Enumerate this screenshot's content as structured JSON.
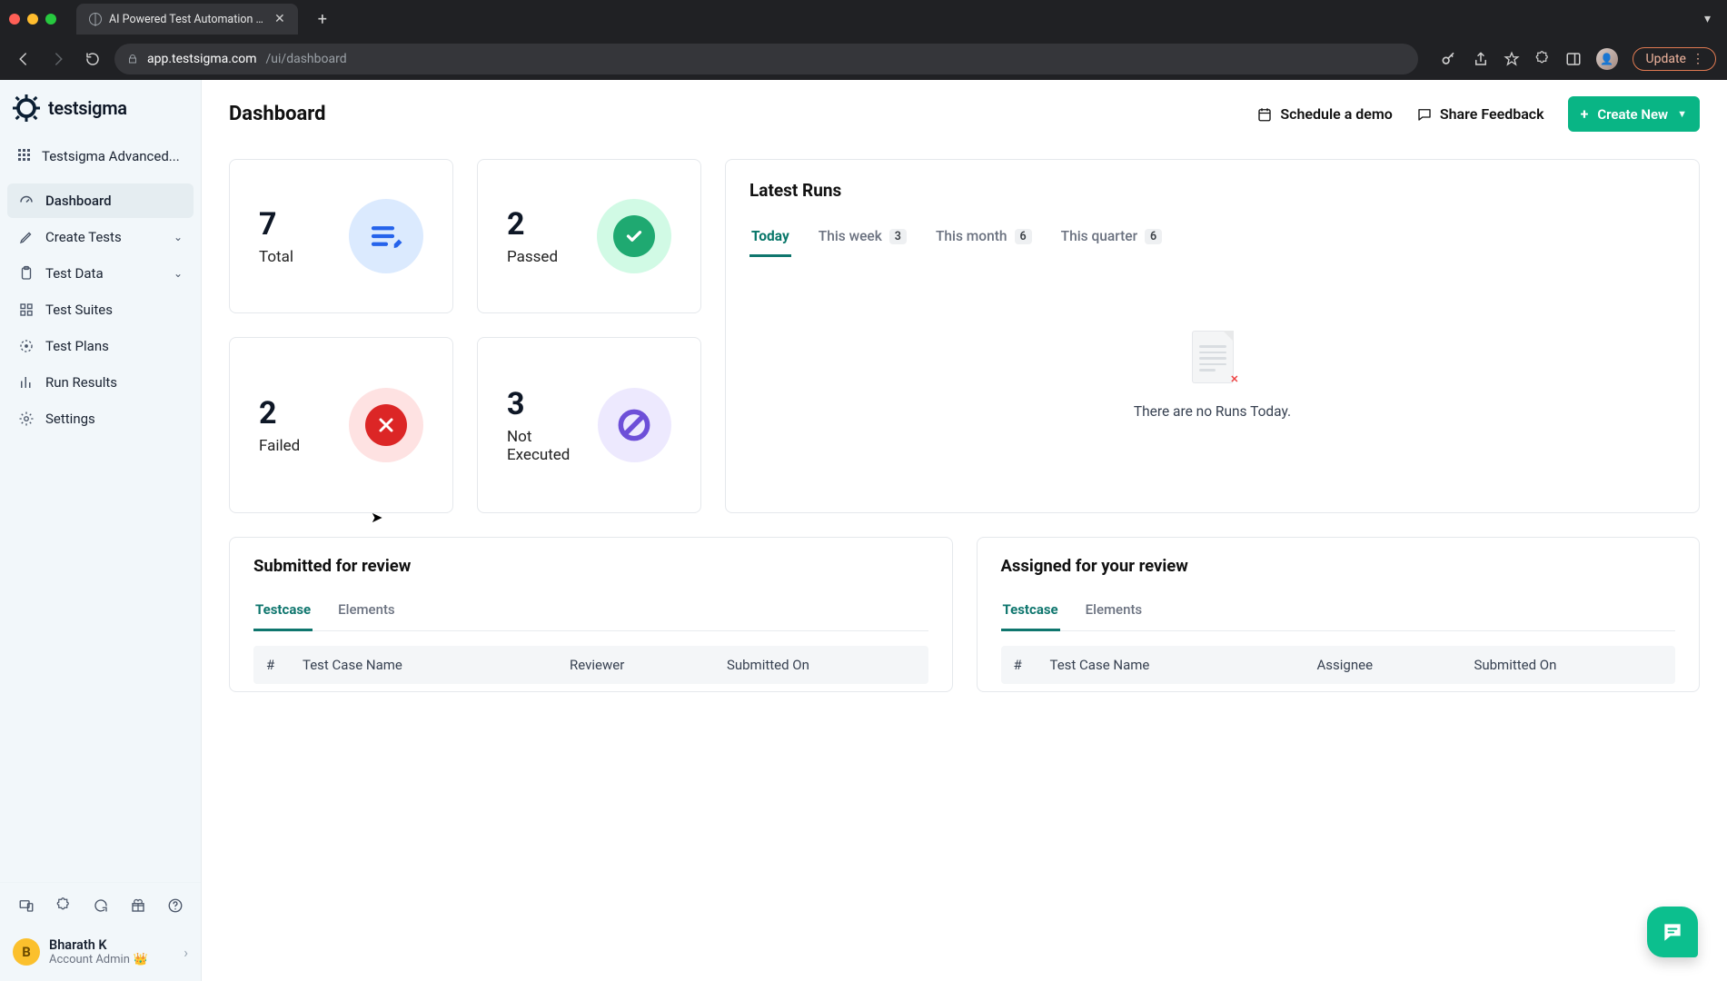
{
  "chrome": {
    "tab_title": "AI Powered Test Automation Pl",
    "url_host": "app.testsigma.com",
    "url_path": "/ui/dashboard",
    "update_label": "Update"
  },
  "brand": {
    "name": "testsigma"
  },
  "project": {
    "name": "Testsigma Advanced..."
  },
  "nav": {
    "dashboard": "Dashboard",
    "create_tests": "Create Tests",
    "test_data": "Test Data",
    "test_suites": "Test Suites",
    "test_plans": "Test Plans",
    "run_results": "Run Results",
    "settings": "Settings"
  },
  "user": {
    "initial": "B",
    "name": "Bharath K",
    "role": "Account Admin"
  },
  "header": {
    "title": "Dashboard",
    "schedule_demo": "Schedule a demo",
    "share_feedback": "Share Feedback",
    "create_new": "Create New"
  },
  "stats": {
    "total": {
      "value": "7",
      "label": "Total"
    },
    "passed": {
      "value": "2",
      "label": "Passed"
    },
    "failed": {
      "value": "2",
      "label": "Failed"
    },
    "not_executed": {
      "value": "3",
      "label": "Not Executed"
    }
  },
  "runs": {
    "title": "Latest Runs",
    "tabs": {
      "today": "Today",
      "week": "This week",
      "week_count": "3",
      "month": "This month",
      "month_count": "6",
      "quarter": "This quarter",
      "quarter_count": "6"
    },
    "empty_text": "There are no Runs Today."
  },
  "review": {
    "submitted": {
      "title": "Submitted for review",
      "tab_testcase": "Testcase",
      "tab_elements": "Elements",
      "col_hash": "#",
      "col_name": "Test Case Name",
      "col_reviewer": "Reviewer",
      "col_submitted": "Submitted On"
    },
    "assigned": {
      "title": "Assigned for your review",
      "tab_testcase": "Testcase",
      "tab_elements": "Elements",
      "col_hash": "#",
      "col_name": "Test Case Name",
      "col_assignee": "Assignee",
      "col_submitted": "Submitted On"
    }
  }
}
